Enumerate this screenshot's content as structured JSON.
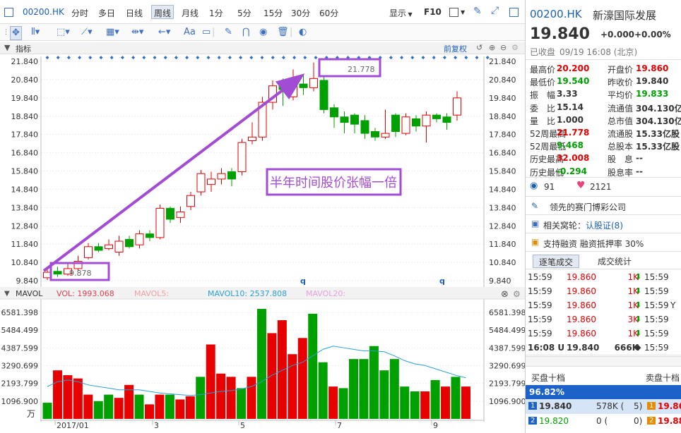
{
  "topbar": {
    "code": "00200.HK",
    "periods": [
      "分时",
      "多日",
      "日线",
      "周线",
      "月线",
      "1分",
      "5分",
      "15分",
      "30分",
      "60分"
    ],
    "active_period": "周线",
    "display_label": "显示",
    "f10_label": "F10"
  },
  "toolbar": {
    "font_label": "Aa"
  },
  "price_panel": {
    "title": "指标",
    "adjust_label": "前复权",
    "annotation_text": "半年时间股价张幅一倍",
    "high_label": "21.778",
    "low_label": "9.878",
    "markers": [
      "q",
      "q"
    ]
  },
  "volume_panel": {
    "title": "MAVOL",
    "vol_label": "VOL: 1993.068",
    "mavol5_label": "MAVOL5:",
    "mavol10_label": "MAVOL10: 2537.808",
    "mavol20_label": "MAVOL20:",
    "unit_label": "万"
  },
  "colors": {
    "up": "#e60000",
    "down": "#00a000",
    "accent": "#a24bd3",
    "ma_line": "#2a9fd6"
  },
  "chart_data": [
    {
      "type": "candlestick",
      "title": "",
      "y_ticks": [
        "21.840",
        "20.840",
        "19.840",
        "18.840",
        "17.840",
        "16.840",
        "15.840",
        "14.840",
        "13.840",
        "12.840",
        "11.840",
        "10.840",
        "9.840"
      ],
      "ylim": [
        9.84,
        21.84
      ],
      "x_labels": [
        "2017/01",
        "3",
        "5",
        "7",
        "9"
      ],
      "candles": [
        {
          "o": 10.0,
          "c": 10.3,
          "h": 10.5,
          "l": 9.878
        },
        {
          "o": 10.35,
          "c": 10.2,
          "h": 10.6,
          "l": 10.05
        },
        {
          "o": 10.2,
          "c": 10.5,
          "h": 10.8,
          "l": 10.1
        },
        {
          "o": 10.5,
          "c": 10.9,
          "h": 11.2,
          "l": 10.4
        },
        {
          "o": 11.1,
          "c": 11.7,
          "h": 11.9,
          "l": 11.0
        },
        {
          "o": 11.7,
          "c": 11.5,
          "h": 11.9,
          "l": 11.4
        },
        {
          "o": 11.6,
          "c": 11.8,
          "h": 12.1,
          "l": 11.5
        },
        {
          "o": 11.4,
          "c": 12.0,
          "h": 12.3,
          "l": 11.2
        },
        {
          "o": 12.1,
          "c": 11.7,
          "h": 12.3,
          "l": 11.6
        },
        {
          "o": 11.8,
          "c": 12.4,
          "h": 12.6,
          "l": 11.6
        },
        {
          "o": 12.4,
          "c": 12.2,
          "h": 12.6,
          "l": 12.0
        },
        {
          "o": 12.2,
          "c": 13.8,
          "h": 14.0,
          "l": 12.1
        },
        {
          "o": 13.8,
          "c": 13.2,
          "h": 13.9,
          "l": 13.0
        },
        {
          "o": 13.3,
          "c": 13.6,
          "h": 13.9,
          "l": 13.0
        },
        {
          "o": 13.9,
          "c": 14.5,
          "h": 14.7,
          "l": 13.7
        },
        {
          "o": 14.7,
          "c": 15.7,
          "h": 15.9,
          "l": 14.5
        },
        {
          "o": 15.1,
          "c": 15.4,
          "h": 15.8,
          "l": 14.7
        },
        {
          "o": 15.4,
          "c": 15.7,
          "h": 16.0,
          "l": 15.1
        },
        {
          "o": 15.8,
          "c": 15.4,
          "h": 16.0,
          "l": 15.0
        },
        {
          "o": 15.8,
          "c": 17.4,
          "h": 17.6,
          "l": 15.6
        },
        {
          "o": 17.5,
          "c": 17.7,
          "h": 18.5,
          "l": 17.3
        },
        {
          "o": 17.7,
          "c": 19.6,
          "h": 19.9,
          "l": 17.5
        },
        {
          "o": 19.6,
          "c": 20.5,
          "h": 20.8,
          "l": 19.2
        },
        {
          "o": 20.6,
          "c": 20.3,
          "h": 20.9,
          "l": 19.4
        },
        {
          "o": 19.9,
          "c": 20.5,
          "h": 21.4,
          "l": 19.7
        },
        {
          "o": 20.6,
          "c": 20.4,
          "h": 21.1,
          "l": 20.0
        },
        {
          "o": 20.4,
          "c": 20.9,
          "h": 21.778,
          "l": 20.2
        },
        {
          "o": 20.8,
          "c": 19.2,
          "h": 21.0,
          "l": 19.0
        },
        {
          "o": 19.3,
          "c": 18.8,
          "h": 19.5,
          "l": 18.2
        },
        {
          "o": 18.8,
          "c": 18.5,
          "h": 19.1,
          "l": 17.9
        },
        {
          "o": 18.9,
          "c": 18.4,
          "h": 19.0,
          "l": 17.9
        },
        {
          "o": 18.6,
          "c": 17.9,
          "h": 18.9,
          "l": 17.6
        },
        {
          "o": 18.0,
          "c": 17.7,
          "h": 18.2,
          "l": 17.5
        },
        {
          "o": 17.7,
          "c": 17.9,
          "h": 19.2,
          "l": 17.6
        },
        {
          "o": 18.9,
          "c": 18.0,
          "h": 19.0,
          "l": 17.7
        },
        {
          "o": 17.9,
          "c": 18.8,
          "h": 19.0,
          "l": 17.8
        },
        {
          "o": 18.7,
          "c": 18.3,
          "h": 18.9,
          "l": 18.0
        },
        {
          "o": 18.3,
          "c": 18.9,
          "h": 19.1,
          "l": 17.4
        },
        {
          "o": 18.9,
          "c": 18.7,
          "h": 19.0,
          "l": 18.5
        },
        {
          "o": 18.8,
          "c": 18.5,
          "h": 19.0,
          "l": 18.1
        },
        {
          "o": 18.9,
          "c": 19.84,
          "h": 20.2,
          "l": 18.6
        }
      ]
    },
    {
      "type": "bar",
      "title": "MAVOL",
      "y_ticks": [
        "6581.398",
        "5484.499",
        "4387.599",
        "3290.699",
        "2193.799",
        "1096.900"
      ],
      "ylim": [
        0,
        6800
      ],
      "values": [
        1000,
        3000,
        2700,
        2500,
        1500,
        1100,
        1500,
        1300,
        2100,
        1500,
        900,
        1500,
        1500,
        1200,
        1400,
        2600,
        4600,
        2800,
        2600,
        1900,
        2600,
        6800,
        5300,
        6100,
        4000,
        5000,
        6500,
        3500,
        2000,
        1900,
        3700,
        3700,
        4500,
        3000,
        3700,
        2000,
        1700,
        1700,
        2400,
        2000,
        2600,
        2000
      ],
      "up": [
        false,
        true,
        true,
        true,
        true,
        false,
        false,
        true,
        true,
        false,
        true,
        true,
        false,
        true,
        true,
        false,
        true,
        true,
        true,
        false,
        true,
        false,
        true,
        true,
        true,
        true,
        false,
        false,
        true,
        false,
        false,
        false,
        false,
        false,
        false,
        false,
        false,
        true,
        false,
        true,
        false,
        true
      ],
      "mavol10": [
        2000,
        2300,
        2400,
        2300,
        2100,
        2000,
        1900,
        1800,
        1800,
        1800,
        1700,
        1600,
        1550,
        1500,
        1450,
        1500,
        1600,
        1700,
        1750,
        1850,
        2000,
        2300,
        2700,
        3000,
        3300,
        3500,
        3900,
        4300,
        4500,
        4400,
        4300,
        4200,
        4200,
        4150,
        3900,
        3600,
        3400,
        3300,
        3100,
        2900,
        2700,
        2537.808
      ]
    }
  ],
  "quote": {
    "code": "00200.HK",
    "name": "新濠国际发展",
    "price": "19.840",
    "change": "+0.000",
    "change_pct": "+0.00%",
    "status": "已收盘",
    "time": "09/19 16:08 (北京)",
    "stats": [
      {
        "label": "最高价",
        "value": "20.200",
        "color": "red",
        "label2": "开盘价",
        "value2": "19.860",
        "color2": "red"
      },
      {
        "label": "最低价",
        "value": "19.540",
        "color": "green",
        "label2": "昨收价",
        "value2": "19.840",
        "color2": "black"
      },
      {
        "label": "振　幅",
        "value": "3.33",
        "color": "black",
        "label2": "平均价",
        "value2": "19.833",
        "color2": "green"
      },
      {
        "label": "委　比",
        "value": "15.14",
        "color": "black",
        "label2": "流通值",
        "value2": "304.130亿",
        "color2": "black"
      },
      {
        "label": "量　比",
        "value": "1.000",
        "color": "black",
        "label2": "总市值",
        "value2": "304.130亿",
        "color2": "black"
      },
      {
        "label": "52周最高",
        "value": "21.778",
        "color": "red",
        "label2": "流通股",
        "value2": "15.33亿股",
        "color2": "black"
      },
      {
        "label": "52周最低",
        "value": "9.468",
        "color": "green",
        "label2": "总股本",
        "value2": "15.33亿股",
        "color2": "black"
      },
      {
        "label": "历史最高",
        "value": "32.008",
        "color": "red",
        "label2": "股　息",
        "value2": "--",
        "color2": "black"
      },
      {
        "label": "历史最低",
        "value": "-0.294",
        "color": "green",
        "label2": "股息率",
        "value2": "--",
        "color2": "black"
      }
    ],
    "views": "91",
    "likes": "2121",
    "tag1": "领先的赛门博彩公司",
    "warrant_prefix": "相关窝轮：",
    "warrant_link": "认股证(8)",
    "margin_text": "支持融资  融资抵押率 30%",
    "tab_trades": "逐笔成交",
    "tab_stats": "成交统计",
    "trades": [
      {
        "time": "15:59",
        "price": "19.860",
        "vol": "1K",
        "dir": "down",
        "time2": "15:59",
        "flag": ""
      },
      {
        "time": "15:59",
        "price": "19.860",
        "vol": "1K",
        "dir": "down",
        "time2": "15:59",
        "flag": ""
      },
      {
        "time": "15:59",
        "price": "19.860",
        "vol": "1K",
        "dir": "down",
        "time2": "15:59",
        "flag": "Y"
      },
      {
        "time": "15:59",
        "price": "19.860",
        "vol": "3K",
        "dir": "down",
        "time2": "15:59",
        "flag": ""
      },
      {
        "time": "15:59",
        "price": "19.860",
        "vol": "1K",
        "dir": "down",
        "time2": "15:59",
        "flag": ""
      },
      {
        "time": "16:08 U",
        "price": "19.840",
        "vol": "666K",
        "dir": "none",
        "time2": "15:59",
        "flag": ""
      }
    ],
    "bid_title": "买盘十档",
    "ask_title": "卖盘十档",
    "bid_ratio": "96.82%",
    "bids": [
      {
        "level": "1",
        "price": "19.840",
        "vol": "578K (",
        "count": "5)",
        "ask_level": "1",
        "ask_price": "19.860"
      },
      {
        "level": "2",
        "price": "19.820",
        "vol": "0 (",
        "count": "0)",
        "ask_level": "2",
        "ask_price": "19.880"
      }
    ]
  }
}
